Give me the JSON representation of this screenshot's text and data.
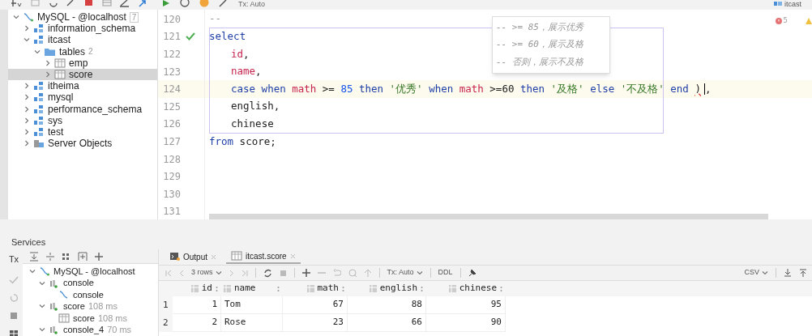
{
  "toolbar": {
    "tx_mode": "Tx: Auto",
    "schema": "itcast"
  },
  "database_tree": [
    {
      "kind": "connection",
      "label": "MySQL - @localhost",
      "count": "7",
      "expanded": true,
      "selected": false,
      "children": [
        {
          "kind": "schema",
          "label": "information_schema",
          "expanded": false,
          "selected": false
        },
        {
          "kind": "schema",
          "label": "itcast",
          "expanded": true,
          "selected": false,
          "children": [
            {
              "kind": "folder",
              "label": "tables",
              "count": "2",
              "expanded": true,
              "selected": false,
              "children": [
                {
                  "kind": "table",
                  "label": "emp",
                  "expanded": false,
                  "selected": false
                },
                {
                  "kind": "table",
                  "label": "score",
                  "expanded": false,
                  "selected": true
                }
              ]
            }
          ]
        },
        {
          "kind": "schema",
          "label": "itheima",
          "expanded": false,
          "selected": false
        },
        {
          "kind": "schema",
          "label": "mysql",
          "expanded": false,
          "selected": false
        },
        {
          "kind": "schema",
          "label": "performance_schema",
          "expanded": false,
          "selected": false
        },
        {
          "kind": "schema",
          "label": "sys",
          "expanded": false,
          "selected": false
        },
        {
          "kind": "schema",
          "label": "test",
          "expanded": false,
          "selected": false
        },
        {
          "kind": "server",
          "label": "Server Objects",
          "expanded": false,
          "selected": false
        }
      ]
    }
  ],
  "editor": {
    "error_count": "5",
    "lines": [
      {
        "number": "120",
        "kind": "clause",
        "current": false,
        "tokens": [
          {
            "kind": "comment",
            "text": "--"
          }
        ]
      },
      {
        "number": "121",
        "kind": "clause",
        "run_ok": true,
        "current": false,
        "tokens": [
          {
            "kind": "keyword",
            "text": "select"
          }
        ]
      },
      {
        "number": "122",
        "kind": "item",
        "current": false,
        "tokens": [
          {
            "kind": "column",
            "text": "id"
          },
          {
            "kind": "plain",
            "text": ","
          }
        ]
      },
      {
        "number": "123",
        "kind": "item",
        "current": false,
        "tokens": [
          {
            "kind": "column",
            "text": "name"
          },
          {
            "kind": "plain",
            "text": ","
          }
        ]
      },
      {
        "number": "124",
        "kind": "item",
        "current": true,
        "tokens": [
          {
            "kind": "keyword",
            "text": "case"
          },
          {
            "kind": "keyword",
            "text": "when"
          },
          {
            "kind": "column",
            "text": "math"
          },
          {
            "kind": "plain",
            "text": ">="
          },
          {
            "kind": "number",
            "text": "85"
          },
          {
            "kind": "keyword",
            "text": "then"
          },
          {
            "kind": "string",
            "text": "'优秀'"
          },
          {
            "kind": "keyword",
            "text": "when"
          },
          {
            "kind": "column",
            "text": "math"
          },
          {
            "kind": "plain",
            "text": ">=60"
          },
          {
            "kind": "keyword",
            "text": "then"
          },
          {
            "kind": "string",
            "text": "'及格'"
          },
          {
            "kind": "keyword",
            "text": "else"
          },
          {
            "kind": "string",
            "text": "'不及格'"
          },
          {
            "kind": "keyword",
            "text": "end"
          },
          {
            "kind": "error",
            "text": ")"
          },
          {
            "kind": "plain",
            "text": ","
          }
        ]
      },
      {
        "number": "125",
        "kind": "item",
        "current": false,
        "tokens": [
          {
            "kind": "plain",
            "text": "english,"
          }
        ]
      },
      {
        "number": "126",
        "kind": "item",
        "current": false,
        "tokens": [
          {
            "kind": "plain",
            "text": "chinese"
          }
        ]
      },
      {
        "number": "127",
        "kind": "clause",
        "current": false,
        "tokens": [
          {
            "kind": "keyword",
            "text": "from"
          },
          {
            "kind": "plain",
            "text": "score;"
          }
        ]
      },
      {
        "number": "128",
        "kind": "clause",
        "current": false
      },
      {
        "number": "129",
        "kind": "clause",
        "current": false
      },
      {
        "number": "130",
        "kind": "clause",
        "current": false
      },
      {
        "number": "131",
        "kind": "clause",
        "current": false
      }
    ],
    "tooltip_lines": [
      "-- >= 85，展示优秀",
      "-- >= 60，展示及格",
      "-- 否则，展示不及格"
    ]
  },
  "services": {
    "title": "Services",
    "tx_label": "Tx",
    "tree": [
      {
        "kind": "connection",
        "label": "MySQL - @localhost",
        "expanded": true,
        "children": [
          {
            "kind": "session",
            "label": "console",
            "expanded": true,
            "children": [
              {
                "kind": "console",
                "label": "console"
              }
            ]
          },
          {
            "kind": "session",
            "label": "score",
            "time": "108 ms",
            "expanded": true,
            "children": [
              {
                "kind": "table",
                "label": "score",
                "time": "108 ms"
              }
            ]
          },
          {
            "kind": "session",
            "label": "console_4",
            "time": "70 ms",
            "expanded": true
          }
        ]
      }
    ]
  },
  "results": {
    "tabs": [
      {
        "label": "Output",
        "selected": false
      },
      {
        "label": "itcast.score",
        "selected": true
      }
    ],
    "rows_label": "3 rows",
    "tx_mode": "Tx: Auto",
    "ddl": "DDL",
    "export_format": "CSV",
    "columns": [
      "id",
      "name",
      "math",
      "english",
      "chinese"
    ],
    "rows": [
      {
        "index": "1",
        "cells": [
          "1",
          "Tom",
          "67",
          "88",
          "95"
        ]
      },
      {
        "index": "2",
        "cells": [
          "2",
          "Rose",
          "23",
          "66",
          "90"
        ]
      }
    ]
  }
}
